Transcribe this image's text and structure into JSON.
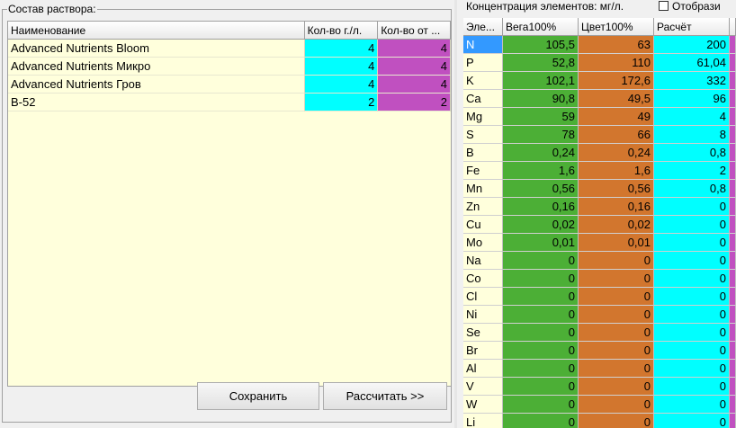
{
  "left_panel": {
    "legend": "Состав раствора:",
    "columns": [
      "Наименование",
      "Кол-во г./л.",
      "Кол-во от ..."
    ],
    "rows": [
      {
        "name": "Advanced Nutrients Bloom",
        "a": "4",
        "b": "4"
      },
      {
        "name": "Advanced Nutrients Микро",
        "a": "4",
        "b": "4"
      },
      {
        "name": "Advanced Nutrients Гров",
        "a": "4",
        "b": "4"
      },
      {
        "name": "B-52",
        "a": "2",
        "b": "2"
      }
    ],
    "save_label": "Сохранить",
    "calc_label": "Рассчитать >>"
  },
  "right_panel": {
    "legend": "Концентрация элементов: мг/л.",
    "checkbox_label": "Отобрази",
    "columns": [
      "Эле...",
      "Вега100%",
      "Цвет100%",
      "Расчёт"
    ],
    "rows": [
      {
        "el": "N",
        "v": "105,5",
        "c": "63",
        "r": "200"
      },
      {
        "el": "P",
        "v": "52,8",
        "c": "110",
        "r": "61,04"
      },
      {
        "el": "K",
        "v": "102,1",
        "c": "172,6",
        "r": "332"
      },
      {
        "el": "Ca",
        "v": "90,8",
        "c": "49,5",
        "r": "96"
      },
      {
        "el": "Mg",
        "v": "59",
        "c": "49",
        "r": "4"
      },
      {
        "el": "S",
        "v": "78",
        "c": "66",
        "r": "8"
      },
      {
        "el": "B",
        "v": "0,24",
        "c": "0,24",
        "r": "0,8"
      },
      {
        "el": "Fe",
        "v": "1,6",
        "c": "1,6",
        "r": "2"
      },
      {
        "el": "Mn",
        "v": "0,56",
        "c": "0,56",
        "r": "0,8"
      },
      {
        "el": "Zn",
        "v": "0,16",
        "c": "0,16",
        "r": "0"
      },
      {
        "el": "Cu",
        "v": "0,02",
        "c": "0,02",
        "r": "0"
      },
      {
        "el": "Mo",
        "v": "0,01",
        "c": "0,01",
        "r": "0"
      },
      {
        "el": "Na",
        "v": "0",
        "c": "0",
        "r": "0"
      },
      {
        "el": "Co",
        "v": "0",
        "c": "0",
        "r": "0"
      },
      {
        "el": "Cl",
        "v": "0",
        "c": "0",
        "r": "0"
      },
      {
        "el": "Ni",
        "v": "0",
        "c": "0",
        "r": "0"
      },
      {
        "el": "Se",
        "v": "0",
        "c": "0",
        "r": "0"
      },
      {
        "el": "Br",
        "v": "0",
        "c": "0",
        "r": "0"
      },
      {
        "el": "Al",
        "v": "0",
        "c": "0",
        "r": "0"
      },
      {
        "el": "V",
        "v": "0",
        "c": "0",
        "r": "0"
      },
      {
        "el": "W",
        "v": "0",
        "c": "0",
        "r": "0"
      },
      {
        "el": "Li",
        "v": "0",
        "c": "0",
        "r": "0"
      }
    ]
  },
  "colors": {
    "grid_bg": "#ffffdc",
    "qty_cyan": "#00ffff",
    "qty_purple": "#c050c0",
    "vega_green": "#4caf36",
    "flower_orange": "#d2762e",
    "selection_blue": "#3399ff"
  }
}
